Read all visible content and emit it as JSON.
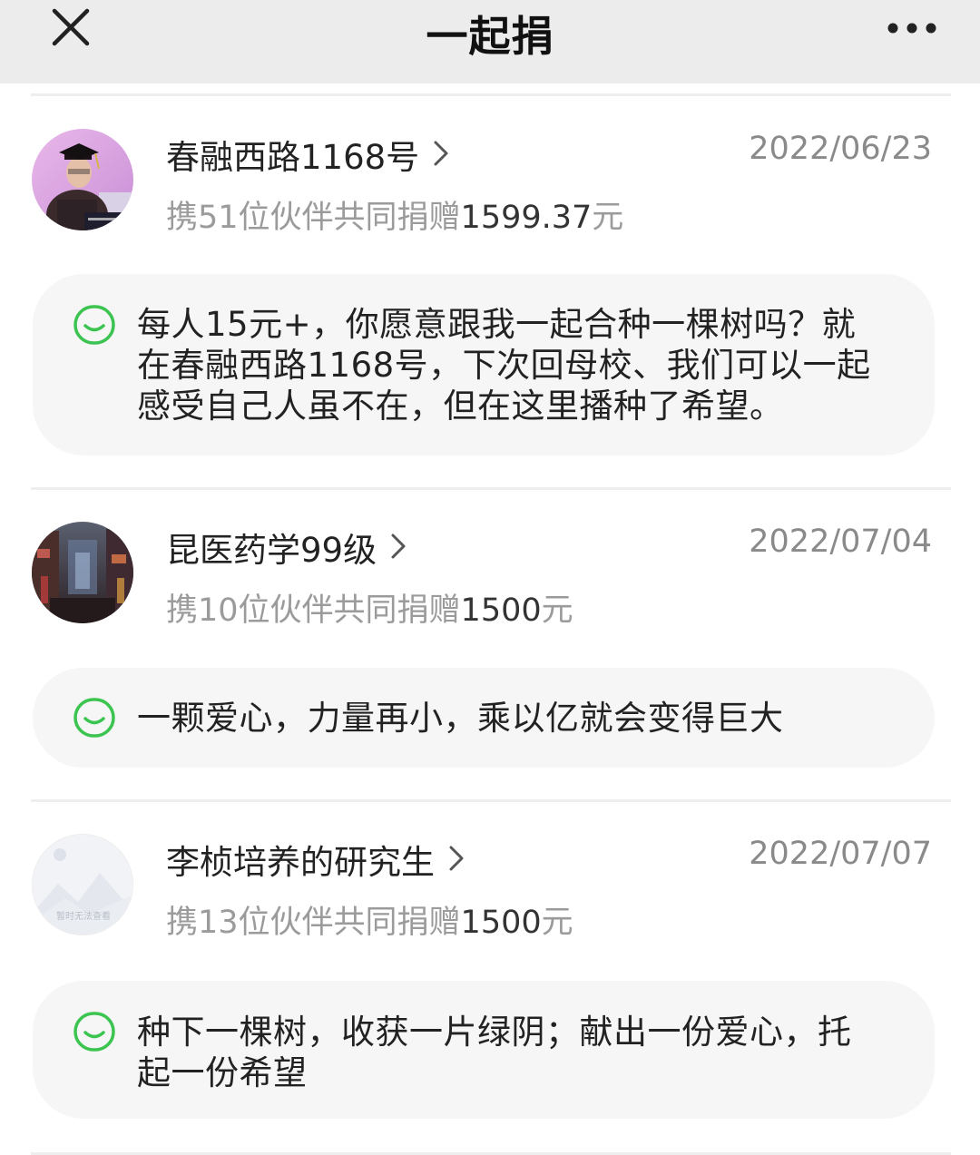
{
  "header": {
    "title": "一起捐",
    "close_icon": "close-icon",
    "more_icon": "more-icon"
  },
  "donations": [
    {
      "name": "春融西路1168号",
      "date": "2022/06/23",
      "summary_prefix": "携51位伙伴共同捐赠",
      "amount": "1599.37",
      "unit": "元",
      "message": "每人15元+，你愿意跟我一起合种一棵树吗？就在春融西路1168号，下次回母校、我们可以一起感受自己人虽不在，但在这里播种了希望。",
      "avatar_icon": "graduate-photo"
    },
    {
      "name": "昆医药学99级",
      "date": "2022/07/04",
      "summary_prefix": "携10位伙伴共同捐赠",
      "amount": "1500",
      "unit": "元",
      "message": "一颗爱心，力量再小，乘以亿就会变得巨大",
      "avatar_icon": "night-street-photo"
    },
    {
      "name": "李桢培养的研究生",
      "date": "2022/07/07",
      "summary_prefix": "携13位伙伴共同捐赠",
      "amount": "1500",
      "unit": "元",
      "message": "种下一棵树，收获一片绿阴；献出一份爱心，托起一份希望",
      "avatar_icon": "placeholder-image",
      "avatar_caption": "暂时无法查看"
    }
  ],
  "colors": {
    "nav_bg": "#ececec",
    "accent_green": "#3cc451",
    "bubble_bg": "#f6f6f6",
    "muted_text": "#9b9b9b"
  }
}
